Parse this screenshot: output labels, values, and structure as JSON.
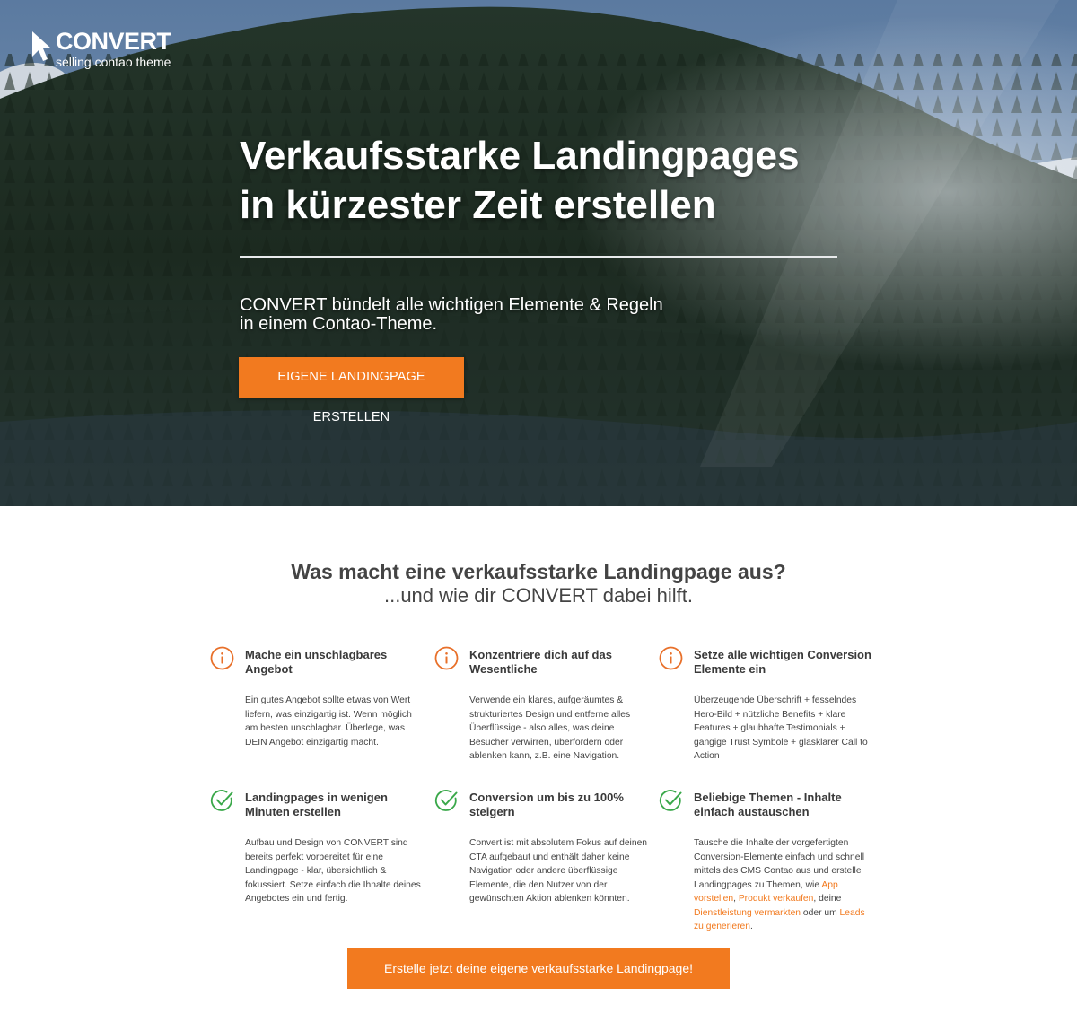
{
  "brand": {
    "name": "CONVERT",
    "tagline": "selling contao theme"
  },
  "hero": {
    "title_line1": "Verkaufsstarke Landingpages",
    "title_line2": "in kürzester Zeit erstellen",
    "subtitle_line1": "CONVERT bündelt alle wichtigen Elemente & Regeln",
    "subtitle_line2": "in einem Contao-Theme.",
    "button_label": "EIGENE LANDINGPAGE ERSTELLEN"
  },
  "section": {
    "title": "Was macht eine verkaufsstarke Landingpage aus?",
    "subtitle": "...und wie dir CONVERT dabei hilft."
  },
  "features_info": [
    {
      "icon": "info-icon",
      "title": "Mache ein unschlagbares Angebot",
      "text": "Ein gutes Angebot sollte etwas von Wert liefern, was einzigartig ist. Wenn möglich am besten unschlagbar. Überlege, was DEIN Angebot einzigartig macht."
    },
    {
      "icon": "info-icon",
      "title": "Konzentriere dich auf das Wesentliche",
      "text": "Verwende ein klares, aufgeräumtes & strukturiertes Design und entferne alles Überflüssige - also alles, was deine Besucher verwirren, überfordern oder ablenken kann, z.B. eine Navigation."
    },
    {
      "icon": "info-icon",
      "title": "Setze alle wichtigen Conversion Elemente ein",
      "text": "Überzeugende Überschrift + fesselndes Hero-Bild + nützliche Benefits + klare Features + glaubhafte Testimonials + gängige Trust Symbole + glasklarer Call to Action"
    }
  ],
  "features_check": [
    {
      "icon": "check-circle-icon",
      "title": "Landingpages in wenigen Minuten erstellen",
      "text": "Aufbau und Design von CONVERT sind bereits perfekt vorbereitet für eine Landingpage - klar, übersichtlich & fokussiert. Setze einfach die Ihnalte deines Angebotes ein und fertig."
    },
    {
      "icon": "check-circle-icon",
      "title": "Conversion um bis zu 100% steigern",
      "text": "Convert ist mit absolutem Fokus auf deinen CTA aufgebaut und enthält daher keine Navigation oder andere überflüssige Elemente, die den Nutzer von der gewünschten Aktion ablenken könnten."
    },
    {
      "icon": "check-circle-icon",
      "title": "Beliebige Themen - Inhalte einfach austauschen",
      "text_before": "Tausche die Inhalte der vorgefertigten Conversion-Elemente einfach und schnell mittels des CMS Contao aus und erstelle Landingpages zu Themen, wie ",
      "link1": "App vorstellen",
      "sep1": ", ",
      "link2": "Produkt verkaufen",
      "sep2": ", deine ",
      "link3": "Dienstleistung vermarkten",
      "sep3": " oder um ",
      "link4": "Leads zu generieren",
      "text_after": "."
    }
  ],
  "cta": {
    "button_label": "Erstelle jetzt deine eigene verkaufsstarke Landingpage!"
  },
  "colors": {
    "accent": "#f27a1f",
    "info_icon": "#e8702a",
    "check_icon": "#3aa84a",
    "heading_text": "#444444"
  }
}
